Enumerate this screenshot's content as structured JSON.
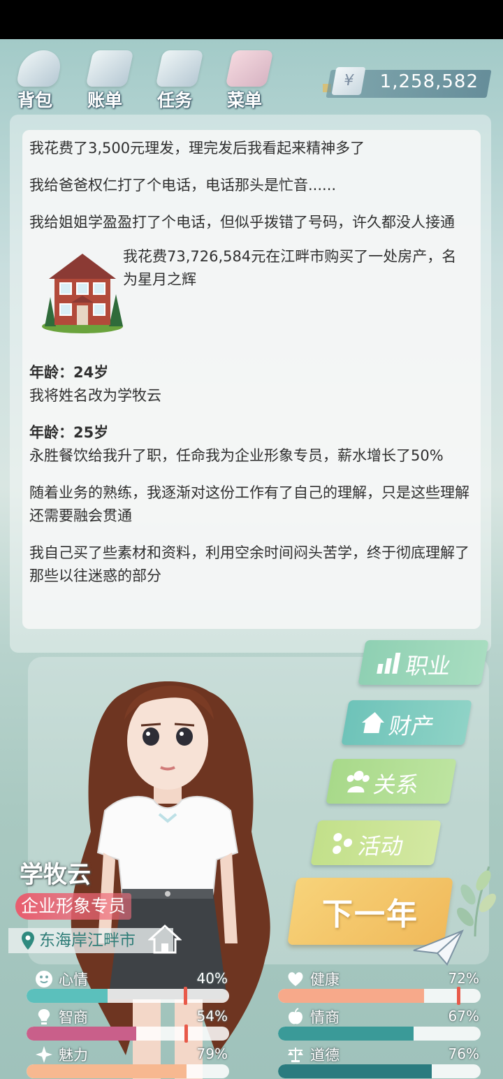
{
  "toolbar": {
    "items": [
      {
        "label": "背包",
        "icon": "backpack-icon"
      },
      {
        "label": "账单",
        "icon": "bill-icon"
      },
      {
        "label": "任务",
        "icon": "task-icon"
      },
      {
        "label": "菜单",
        "icon": "menu-icon"
      }
    ],
    "currency_symbol": "¥",
    "money": "1,258,582"
  },
  "log": {
    "entries": [
      "我花费了3,500元理发，理完发后我看起来精神多了",
      "我给爸爸权仁打了个电话，电话那头是忙音......",
      "我给姐姐学盈盈打了个电话，但似乎拨错了号码，许久都没人接通"
    ],
    "house_entry": "我花费73,726,584元在江畔市购买了一处房产，名为星月之辉",
    "age24_label": "年龄：24岁",
    "age24_entries": [
      "我将姓名改为学牧云"
    ],
    "age25_label": "年龄：25岁",
    "age25_entries": [
      "永胜餐饮给我升了职，任命我为企业形象专员，薪水增长了50%",
      "随着业务的熟练，我逐渐对这份工作有了自己的理解，只是这些理解还需要融会贯通",
      "我自己买了些素材和资料，利用空余时间闷头苦学，终于彻底理解了那些以往迷惑的部分"
    ]
  },
  "side_menu": {
    "career": "职业",
    "property": "财产",
    "relations": "关系",
    "activities": "活动"
  },
  "character": {
    "name": "学牧云",
    "job": "企业形象专员",
    "location": "东海岸江畔市"
  },
  "next_year": "下一年",
  "stats": {
    "mood": {
      "label": "心情",
      "value": "40%",
      "level": 0.4
    },
    "health": {
      "label": "健康",
      "value": "72%",
      "level": 0.72
    },
    "iq": {
      "label": "智商",
      "value": "54%",
      "level": 0.54
    },
    "eq": {
      "label": "情商",
      "value": "67%",
      "level": 0.67
    },
    "charm": {
      "label": "魅力",
      "value": "79%",
      "level": 0.79
    },
    "morality": {
      "label": "道德",
      "value": "76%",
      "level": 0.76
    }
  },
  "colors": {
    "mood_bar": "#5bc0bc",
    "health_bar": "#f7a98a",
    "iq_bar": "#c95f8a",
    "eq_bar": "#3a9a98",
    "charm_bar": "#f7b890",
    "morality_bar": "#2a7b7f",
    "accent_marker": "#e85a4a"
  }
}
